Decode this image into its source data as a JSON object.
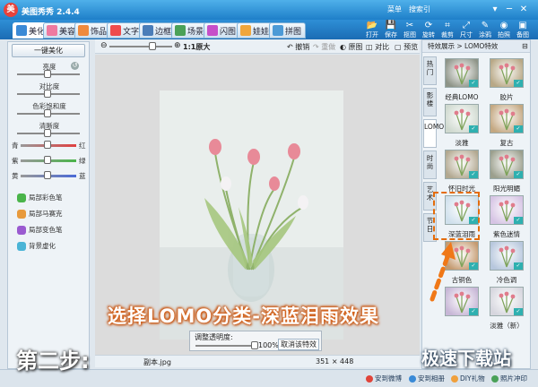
{
  "window": {
    "app_icon": "美",
    "title": "美图秀秀 2.4.4",
    "links": [
      "菜单",
      "搜索引"
    ],
    "controls": [
      "▾",
      "─",
      "✕"
    ]
  },
  "nav": {
    "tabs": [
      {
        "label": "美化",
        "icon": "beautify-icon",
        "color": "#3b8ad6"
      },
      {
        "label": "美容",
        "icon": "makeup-icon",
        "color": "#ef7aa0"
      },
      {
        "label": "饰品",
        "icon": "ornament-icon",
        "color": "#f08a3c"
      },
      {
        "label": "文字",
        "icon": "text-icon",
        "color": "#ef4c4c"
      },
      {
        "label": "边框",
        "icon": "frame-icon",
        "color": "#4a7db8"
      },
      {
        "label": "场景",
        "icon": "scene-icon",
        "color": "#4aa158"
      },
      {
        "label": "闪图",
        "icon": "flash-icon",
        "color": "#c64fc9"
      },
      {
        "label": "娃娃",
        "icon": "doll-icon",
        "color": "#f0a63c"
      },
      {
        "label": "拼图",
        "icon": "puzzle-icon",
        "color": "#4c9ad6"
      }
    ]
  },
  "tools": [
    {
      "label": "打开",
      "glyph": "📂"
    },
    {
      "label": "保存",
      "glyph": "💾"
    },
    {
      "label": "抠图",
      "glyph": "✂"
    },
    {
      "label": "旋转",
      "glyph": "⟳"
    },
    {
      "label": "裁剪",
      "glyph": "⌗"
    },
    {
      "label": "尺寸",
      "glyph": "⤢"
    },
    {
      "label": "涂鸦",
      "glyph": "✎"
    },
    {
      "label": "拍照",
      "glyph": "◉"
    },
    {
      "label": "备图",
      "glyph": "▣"
    }
  ],
  "left": {
    "one_click": "一键美化",
    "sliders": [
      "亮度",
      "对比度",
      "色彩饱和度",
      "清晰度"
    ],
    "color_bars": [
      {
        "left": "青",
        "right": "红",
        "color": "#e04040"
      },
      {
        "left": "紫",
        "right": "绿",
        "color": "#4ab44a"
      },
      {
        "left": "黄",
        "right": "蓝",
        "color": "#4a6ad6"
      }
    ],
    "effects": [
      {
        "label": "局部彩色笔",
        "color": "#4ab44a"
      },
      {
        "label": "局部马赛克",
        "color": "#e89a3c"
      },
      {
        "label": "局部变色笔",
        "color": "#9a5ad0"
      },
      {
        "label": "背景虚化",
        "color": "#4ab4d6"
      }
    ]
  },
  "edit_toolbar": {
    "zoom_label": "1:1原大",
    "undo": "撤销",
    "redo": "重做",
    "original": "原图",
    "compare": "对比",
    "preview": "预览"
  },
  "opacity": {
    "label": "调整透明度:",
    "value": "100%",
    "cancel": "取消该特效"
  },
  "status": {
    "filename": "副本.jpg",
    "size": "351 × 448"
  },
  "right": {
    "header": "特效展示 > LOMO特效",
    "vtabs": [
      "热门",
      "影楼",
      "LOMO",
      "时尚",
      "艺术",
      "节日"
    ],
    "thumbs": [
      {
        "label": "经典LOMO",
        "tone": "#8e9488"
      },
      {
        "label": "胶片",
        "tone": "#b8a886"
      },
      {
        "label": "淡雅",
        "tone": "#cfd9cf"
      },
      {
        "label": "复古",
        "tone": "#c4a882"
      },
      {
        "label": "怀旧时光",
        "tone": "#b2a890"
      },
      {
        "label": "阳光明媚",
        "tone": "#9ca08e"
      },
      {
        "label": "深蓝泪雨",
        "tone": "#cfe0ec"
      },
      {
        "label": "紫色迷情",
        "tone": "#d6c4e4"
      },
      {
        "label": "古铜色",
        "tone": "#c49a70"
      },
      {
        "label": "冷色调",
        "tone": "#b7c7dd"
      },
      {
        "label": "",
        "tone": "#c7b6d6"
      },
      {
        "label": "淡雅（新）",
        "tone": "#d6d6de"
      }
    ]
  },
  "bottom": {
    "links": [
      "安到微博",
      "安到相册",
      "DIY礼物",
      "照片冲印"
    ]
  },
  "overlay": {
    "caption": "选择LOMO分类-深蓝泪雨效果",
    "step": "第二步:",
    "watermark": "极速下载站"
  }
}
